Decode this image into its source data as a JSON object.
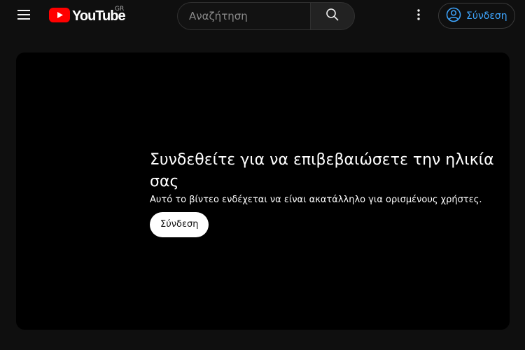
{
  "header": {
    "logo_text": "YouTube",
    "country_code": "GR",
    "search": {
      "placeholder": "Αναζήτηση"
    },
    "signin_label": "Σύνδεση",
    "icons": {
      "menu": "hamburger-menu-icon",
      "search": "magnifier-icon",
      "more": "vertical-dots-icon",
      "account": "user-circle-icon"
    }
  },
  "player": {
    "title": "Συνδεθείτε για να επιβεβαιώσετε την ηλικία σας",
    "subtitle": "Αυτό το βίντεο ενδέχεται να είναι ακατάλληλο για ορισμένους χρήστες.",
    "button_label": "Σύνδεση"
  },
  "colors": {
    "background": "#0f0f0f",
    "player_background": "#000000",
    "accent": "#3ea6ff",
    "logo_red": "#ff0000"
  }
}
